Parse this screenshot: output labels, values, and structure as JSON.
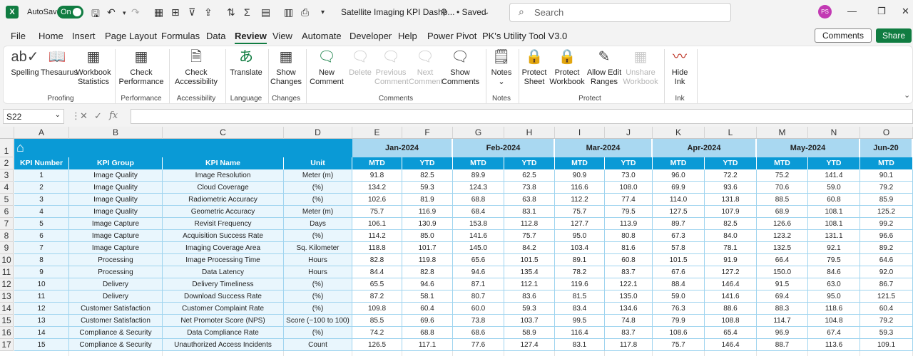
{
  "titlebar": {
    "autosave_label": "AutoSave",
    "toggle": "On",
    "doc_title": "Satellite Imaging KPI Dashb...",
    "saved": "• Saved",
    "search_placeholder": "Search",
    "avatar": "PS"
  },
  "menu": [
    "File",
    "Home",
    "Insert",
    "Page Layout",
    "Formulas",
    "Data",
    "Review",
    "View",
    "Automate",
    "Developer",
    "Help",
    "Power Pivot",
    "PK's Utility Tool V3.0"
  ],
  "active_menu": "Review",
  "buttons": {
    "comments": "Comments",
    "share": "Share"
  },
  "ribbon": {
    "spelling": "Spelling",
    "thesaurus": "Thesaurus",
    "workbook_statistics": "Workbook Statistics",
    "proofing": "Proofing",
    "check_performance": "Check Performance",
    "performance": "Performance",
    "check_accessibility": "Check Accessibility",
    "accessibility": "Accessibility",
    "translate": "Translate",
    "language": "Language",
    "show_changes": "Show Changes",
    "changes": "Changes",
    "new_comment": "New Comment",
    "delete": "Delete",
    "previous_comment": "Previous Comment",
    "next_comment": "Next Comment",
    "show_comments": "Show Comments",
    "comments": "Comments",
    "notes_btn": "Notes",
    "notes": "Notes",
    "protect_sheet": "Protect Sheet",
    "protect_workbook": "Protect Workbook",
    "allow_edit_ranges": "Allow Edit Ranges",
    "unshare_workbook": "Unshare Workbook",
    "protect": "Protect",
    "hide_ink": "Hide Ink",
    "ink": "Ink"
  },
  "formula_bar": {
    "name_box": "S22",
    "fx": "fx",
    "formula": ""
  },
  "columns": [
    "A",
    "B",
    "C",
    "D",
    "E",
    "F",
    "G",
    "H",
    "I",
    "J",
    "K",
    "L",
    "M",
    "N",
    "O"
  ],
  "rows": [
    "1",
    "2",
    "3",
    "4",
    "5",
    "6",
    "7",
    "8",
    "9",
    "10",
    "11",
    "12",
    "13",
    "14",
    "15",
    "16",
    "17"
  ],
  "months": [
    "Jan-2024",
    "Feb-2024",
    "Mar-2024",
    "Apr-2024",
    "May-2024",
    "Jun-20"
  ],
  "table_headers": [
    "KPI Number",
    "KPI Group",
    "KPI Name",
    "Unit"
  ],
  "mtd": "MTD",
  "ytd": "YTD",
  "table_rows": [
    [
      "1",
      "Image Quality",
      "Image Resolution",
      "Meter (m)",
      "91.8",
      "82.5",
      "89.9",
      "62.5",
      "90.9",
      "73.0",
      "96.0",
      "72.2",
      "75.2",
      "141.4",
      "90.1"
    ],
    [
      "2",
      "Image Quality",
      "Cloud Coverage",
      "(%)",
      "134.2",
      "59.3",
      "124.3",
      "73.8",
      "116.6",
      "108.0",
      "69.9",
      "93.6",
      "70.6",
      "59.0",
      "79.2"
    ],
    [
      "3",
      "Image Quality",
      "Radiometric Accuracy",
      "(%)",
      "102.6",
      "81.9",
      "68.8",
      "63.8",
      "112.2",
      "77.4",
      "114.0",
      "131.8",
      "88.5",
      "60.8",
      "85.9"
    ],
    [
      "4",
      "Image Quality",
      "Geometric Accuracy",
      "Meter (m)",
      "75.7",
      "116.9",
      "68.4",
      "83.1",
      "75.7",
      "79.5",
      "127.5",
      "107.9",
      "68.9",
      "108.1",
      "125.2"
    ],
    [
      "5",
      "Image Capture",
      "Revisit Frequency",
      "Days",
      "106.1",
      "130.9",
      "153.8",
      "112.8",
      "127.7",
      "113.9",
      "89.7",
      "82.5",
      "126.6",
      "108.1",
      "99.2"
    ],
    [
      "6",
      "Image Capture",
      "Acquisition Success Rate",
      "(%)",
      "114.2",
      "85.0",
      "141.6",
      "75.7",
      "95.0",
      "80.8",
      "67.3",
      "84.0",
      "123.2",
      "131.1",
      "96.6"
    ],
    [
      "7",
      "Image Capture",
      "Imaging Coverage Area",
      "Sq. Kilometer",
      "118.8",
      "101.7",
      "145.0",
      "84.2",
      "103.4",
      "81.6",
      "57.8",
      "78.1",
      "132.5",
      "92.1",
      "89.2"
    ],
    [
      "8",
      "Processing",
      "Image Processing Time",
      "Hours",
      "82.8",
      "119.8",
      "65.6",
      "101.5",
      "89.1",
      "60.8",
      "101.5",
      "91.9",
      "66.4",
      "79.5",
      "64.6"
    ],
    [
      "9",
      "Processing",
      "Data Latency",
      "Hours",
      "84.4",
      "82.8",
      "94.6",
      "135.4",
      "78.2",
      "83.7",
      "67.6",
      "127.2",
      "150.0",
      "84.6",
      "92.0"
    ],
    [
      "10",
      "Delivery",
      "Delivery Timeliness",
      "(%)",
      "65.5",
      "94.6",
      "87.1",
      "112.1",
      "119.6",
      "122.1",
      "88.4",
      "146.4",
      "91.5",
      "63.0",
      "86.7"
    ],
    [
      "11",
      "Delivery",
      "Download Success Rate",
      "(%)",
      "87.2",
      "58.1",
      "80.7",
      "83.6",
      "81.5",
      "135.0",
      "59.0",
      "141.6",
      "69.4",
      "95.0",
      "121.5"
    ],
    [
      "12",
      "Customer Satisfaction",
      "Customer Complaint Rate",
      "(%)",
      "109.8",
      "60.4",
      "60.0",
      "59.3",
      "83.4",
      "134.6",
      "76.3",
      "88.6",
      "88.3",
      "118.6",
      "60.4"
    ],
    [
      "13",
      "Customer Satisfaction",
      "Net Promoter Score (NPS)",
      "Score (−100 to 100)",
      "85.5",
      "69.6",
      "73.8",
      "103.7",
      "99.5",
      "74.8",
      "79.9",
      "108.8",
      "114.7",
      "104.8",
      "79.2"
    ],
    [
      "14",
      "Compliance & Security",
      "Data Compliance Rate",
      "(%)",
      "74.2",
      "68.8",
      "68.6",
      "58.9",
      "116.4",
      "83.7",
      "108.6",
      "65.4",
      "96.9",
      "67.4",
      "59.3"
    ],
    [
      "15",
      "Compliance & Security",
      "Unauthorized Access Incidents",
      "Count",
      "126.5",
      "117.1",
      "77.6",
      "127.4",
      "83.1",
      "117.8",
      "75.7",
      "146.4",
      "88.7",
      "113.6",
      "109.1"
    ]
  ]
}
